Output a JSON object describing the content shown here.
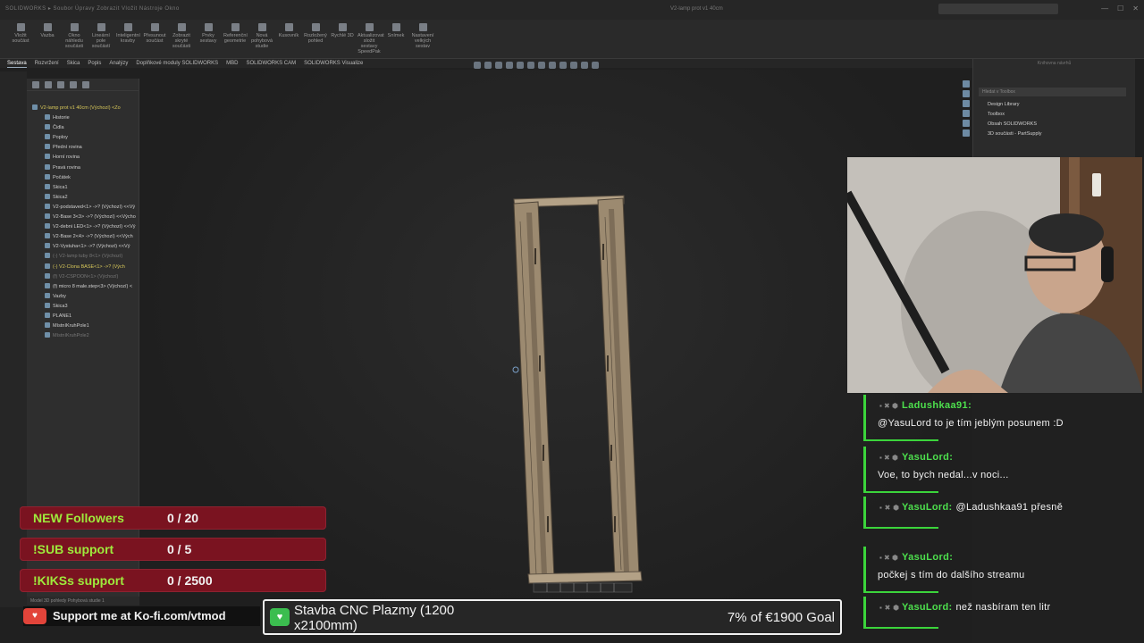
{
  "ribbon": {
    "tools": [
      "Vložit součást",
      "Vazba",
      "Okno náhledu součásti",
      "Lineární pole součástí",
      "Inteligentní kravby",
      "Přesunout součást",
      "Zobrazit skryté součásti",
      "Prvky sestavy",
      "Referenční geometrie",
      "Nová pohybová studie",
      "Kusovník",
      "Rozložený pohled",
      "Rychlé 3D",
      "Aktualizovat složit sestavy SpeedPak",
      "Snímek",
      "Nastavení velkých sestav"
    ],
    "tabs": [
      "Sestava",
      "Rozvržení",
      "Skica",
      "Popis",
      "Analýzy",
      "Doplňkové moduly SOLIDWORKS",
      "MBD",
      "SOLIDWORKS CAM",
      "SOLIDWORKS Visualize"
    ]
  },
  "feature_tree": {
    "items": [
      {
        "label": "V2-lamp prot v1 40cm (Výchozí) <Zo",
        "style": "warn"
      },
      {
        "label": "Historie",
        "style": ""
      },
      {
        "label": "Čidla",
        "style": ""
      },
      {
        "label": "Poploy",
        "style": ""
      },
      {
        "label": "Přední rovina",
        "style": ""
      },
      {
        "label": "Horní rovina",
        "style": ""
      },
      {
        "label": "Pravá rovina",
        "style": ""
      },
      {
        "label": "Počátek",
        "style": ""
      },
      {
        "label": "Skica1",
        "style": ""
      },
      {
        "label": "Skica2",
        "style": ""
      },
      {
        "label": "V2-podstaved<1> ->? (Výchozí) <<Vý",
        "style": ""
      },
      {
        "label": "V2-Base 3<3> ->? (Výchozí) <<Výcho",
        "style": ""
      },
      {
        "label": "V2-debni LED<1> ->? (Výchozí) <<Vý",
        "style": ""
      },
      {
        "label": "V2-Base 2<4> ->? (Výchozí) <<Vých",
        "style": ""
      },
      {
        "label": "V2-Vystuha<1> ->? (Výchozí) <<Vý",
        "style": ""
      },
      {
        "label": "(-) V2-lamp tuby 8<1> (Výchozí)",
        "style": "dim"
      },
      {
        "label": "(-) V2-Clona BASE<1> ->? (Vých",
        "style": "warn"
      },
      {
        "label": "(f) V2-CSPOON<1> (Výchozí)",
        "style": "dim"
      },
      {
        "label": "(f) micro 8 male.step<3> (Výchozí) <",
        "style": ""
      },
      {
        "label": "Vazby",
        "style": ""
      },
      {
        "label": "Skica3",
        "style": ""
      },
      {
        "label": "PLANE1",
        "style": ""
      },
      {
        "label": "MístníKruhPole1",
        "style": ""
      },
      {
        "label": "MístníKruhPole2",
        "style": "dim"
      }
    ]
  },
  "task_pane": {
    "title": "Knihovna návrhů",
    "search_placeholder": "Hledat v Toolbox",
    "items": [
      "Design Library",
      "Toolbox",
      "Obsah SOLIDWORKS",
      "3D součásti - PartSupply"
    ]
  },
  "chat": [
    {
      "user": "Ladushkaa91:",
      "text": "@YasuLord to je tím jeblým posunem :D",
      "inline": false
    },
    {
      "user": "YasuLord:",
      "text": "Voe, to bych nedal...v noci...",
      "inline": false
    },
    {
      "user": "YasuLord:",
      "text": "@Ladushkaa91 přesně",
      "inline": true
    },
    {
      "user": "YasuLord:",
      "text": "počkej s tím do dalšího streamu",
      "inline": false
    },
    {
      "user": "YasuLord:",
      "text": "než nasbíram ten litr",
      "inline": true
    }
  ],
  "goals": [
    {
      "name": "NEW Followers",
      "count": "0 / 20"
    },
    {
      "name": "!SUB support",
      "count": "0 / 5"
    },
    {
      "name": "!KIKSs support",
      "count": "0 / 2500"
    }
  ],
  "kofi": {
    "text": "Support me at Ko-fi.com/vtmod"
  },
  "donation_goal": {
    "title": "Stavba CNC Plazmy (1200 x2100mm)",
    "progress_text": "7% of €1900 Goal",
    "progress_fraction": 0.07
  },
  "left_bottom": {
    "tabs": "Model  3D pohledy  Pohybová studie 1"
  },
  "colors": {
    "goal_bg": "#7a1320",
    "goal_name": "#9eea3c",
    "chat_accent": "#3bd43b",
    "part_wood": "#a08d74"
  }
}
